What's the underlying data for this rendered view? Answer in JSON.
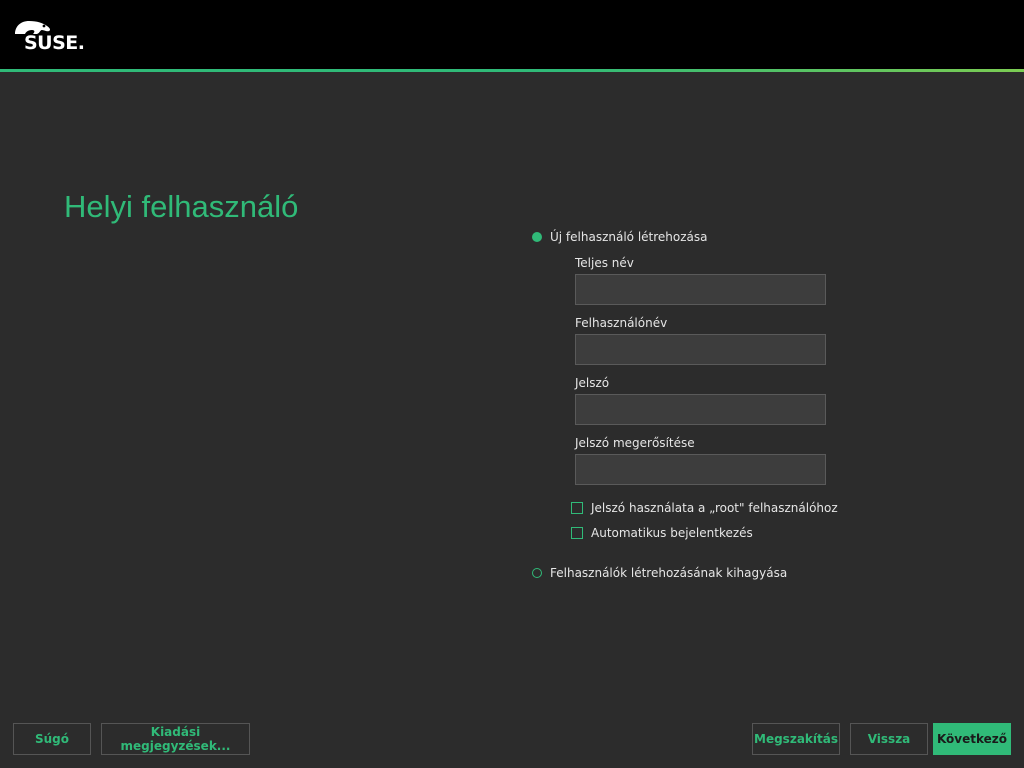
{
  "brand": {
    "logo_text": "SUSE."
  },
  "page": {
    "title": "Helyi felhasználó"
  },
  "create_user": {
    "radio_label": "Új felhasználó létrehozása",
    "full_name": {
      "label": "Teljes név",
      "value": ""
    },
    "username": {
      "label": "Felhasználónév",
      "value": ""
    },
    "password": {
      "label": "Jelszó",
      "value": ""
    },
    "password_confirm": {
      "label": "Jelszó megerősítése",
      "value": ""
    },
    "use_for_root_label": "Jelszó használata a „root\" felhasználóhoz",
    "autologin_label": "Automatikus bejelentkezés"
  },
  "skip_user": {
    "radio_label": "Felhasználók létrehozásának kihagyása"
  },
  "buttons": {
    "help": "Súgó",
    "release_notes": "Kiadási megjegyzések...",
    "abort": "Megszakítás",
    "back": "Vissza",
    "next": "Következő"
  },
  "colors": {
    "accent": "#30ba78",
    "background": "#2c2c2c",
    "header": "#000000"
  }
}
